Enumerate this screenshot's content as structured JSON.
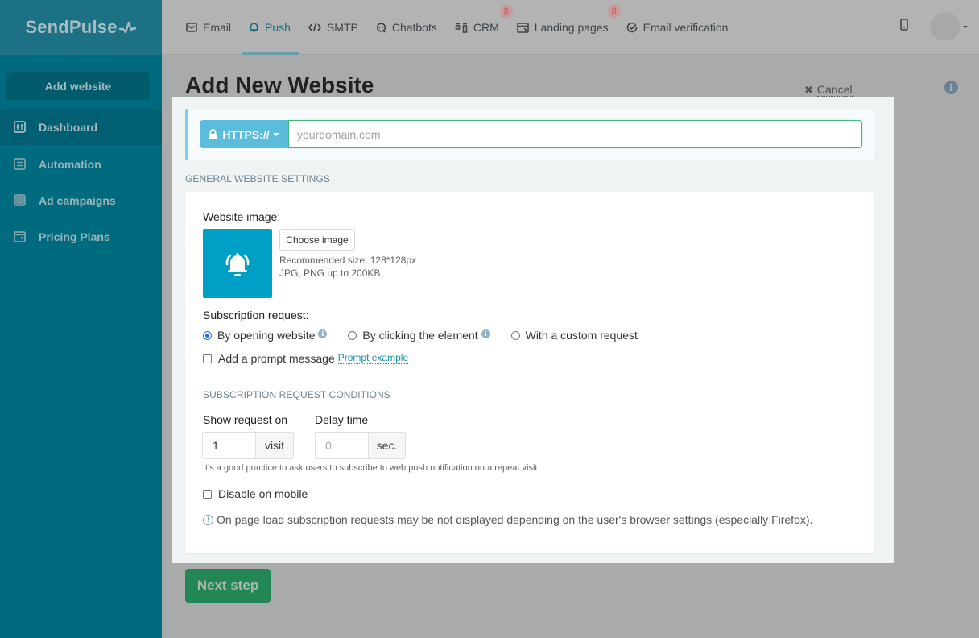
{
  "brand": {
    "name": "SendPulse"
  },
  "nav": {
    "items": [
      {
        "label": "Email",
        "icon": "envelope-icon",
        "active": false,
        "beta": false
      },
      {
        "label": "Push",
        "icon": "bell-icon",
        "active": true,
        "beta": false
      },
      {
        "label": "SMTP",
        "icon": "code-icon",
        "active": false,
        "beta": false
      },
      {
        "label": "Chatbots",
        "icon": "chat-bubble-icon",
        "active": false,
        "beta": false
      },
      {
        "label": "CRM",
        "icon": "kanban-icon",
        "active": false,
        "beta": true
      },
      {
        "label": "Landing pages",
        "icon": "landing-page-icon",
        "active": false,
        "beta": true
      },
      {
        "label": "Email verification",
        "icon": "check-circle-icon",
        "active": false,
        "beta": false
      }
    ],
    "beta_symbol": "β"
  },
  "header_right": {
    "phone_icon": "mobile-phone-icon",
    "avatar": "user-avatar"
  },
  "sidebar": {
    "add_website_label": "Add website",
    "items": [
      {
        "label": "Dashboard",
        "icon": "sliders-icon",
        "active": true
      },
      {
        "label": "Automation",
        "icon": "automation-icon",
        "active": false
      },
      {
        "label": "Ad campaigns",
        "icon": "ad-campaign-icon",
        "active": false
      },
      {
        "label": "Pricing Plans",
        "icon": "wallet-icon",
        "active": false
      }
    ]
  },
  "page": {
    "title": "Add New Website",
    "cancel_label": "Cancel",
    "info_symbol": "i",
    "next_step_label": "Next step"
  },
  "url": {
    "protocol_label": "HTTPS://",
    "placeholder": "yourdomain.com",
    "value": ""
  },
  "general": {
    "section_title": "GENERAL WEBSITE SETTINGS",
    "website_image_label": "Website image:",
    "choose_image_label": "Choose image",
    "recommended_size": "Recommended size: 128*128px",
    "formats": "JPG, PNG up to 200KB",
    "subscription_request_label": "Subscription request:",
    "subscription_options": [
      {
        "label": "By opening website",
        "checked": true,
        "info": true
      },
      {
        "label": "By clicking the element",
        "checked": false,
        "info": true
      },
      {
        "label": "With a custom request",
        "checked": false,
        "info": false
      }
    ],
    "prompt_message_label": "Add a prompt message",
    "prompt_message_checked": false,
    "prompt_example_link": "Prompt example"
  },
  "conditions": {
    "section_title": "SUBSCRIPTION REQUEST CONDITIONS",
    "show_request_label": "Show request on",
    "show_request_value": "1",
    "show_request_unit": "visit",
    "delay_label": "Delay time",
    "delay_placeholder": "0",
    "delay_value": "",
    "delay_unit": "sec.",
    "practice_hint": "It's a good practice to ask users to subscribe to web push notification on a repeat visit",
    "disable_mobile_label": "Disable on mobile",
    "disable_mobile_checked": false,
    "browser_note": "On page load subscription requests may be not displayed depending on the user's browser settings (especially Firefox).",
    "note_symbol": "!"
  },
  "colors": {
    "brand_teal": "#006a7e",
    "protocol_blue": "#5bbcdb",
    "input_border_green": "#3cb878",
    "next_button_green": "#238655",
    "preview_blue": "#00a0c6",
    "link": "#1b8fa8"
  }
}
